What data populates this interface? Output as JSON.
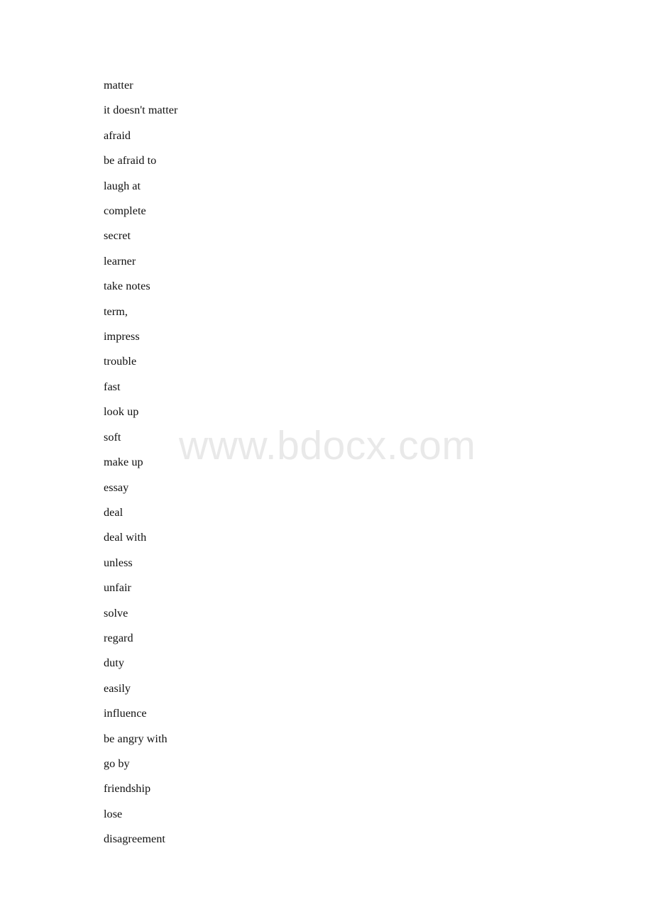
{
  "document": {
    "background_color": "#ffffff",
    "text_color": "#101010"
  },
  "watermark": {
    "text": "www.bdocx.com",
    "color": "#e9e9e9"
  },
  "word_list": {
    "items": [
      "matter",
      "it doesn't matter",
      "afraid",
      "be afraid to",
      "laugh at",
      "complete",
      "secret",
      "learner",
      "take notes",
      "term,",
      "impress",
      "trouble",
      "fast",
      "look up",
      "soft",
      "make up",
      "essay",
      "deal",
      "deal with",
      "unless",
      "unfair",
      "solve",
      "regard",
      "duty",
      "easily",
      "influence",
      "be angry with",
      "go by",
      "friendship",
      "lose",
      "disagreement"
    ]
  }
}
